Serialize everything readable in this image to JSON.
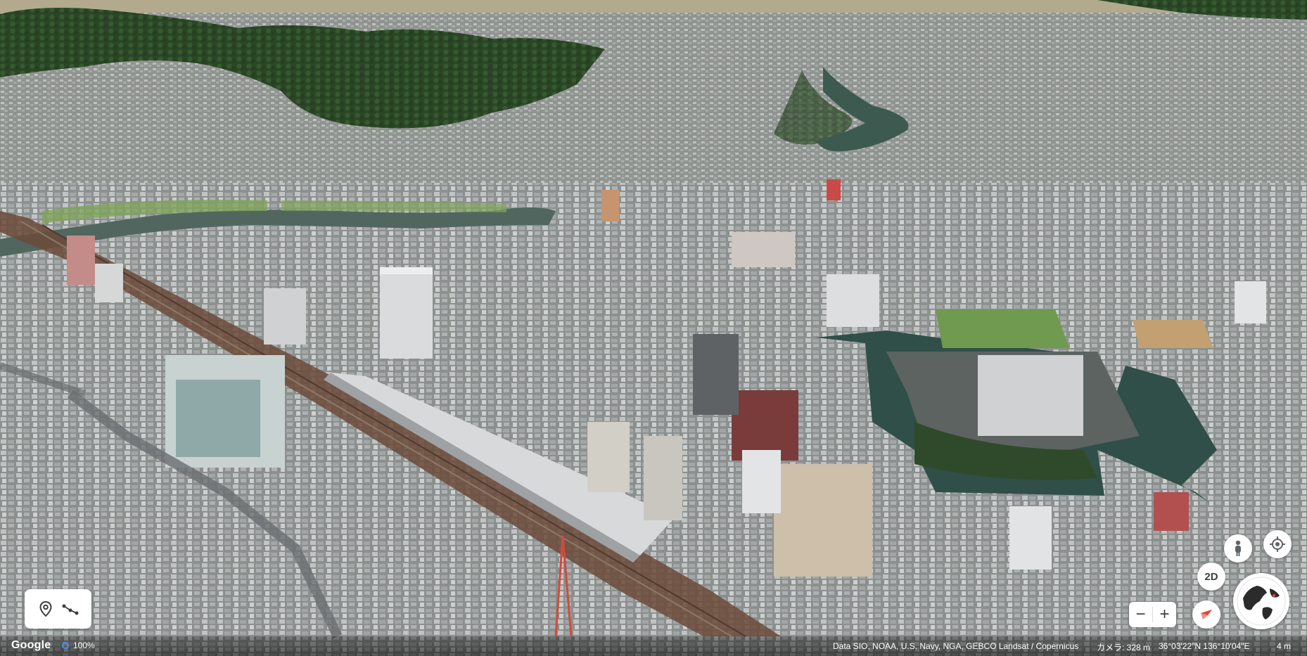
{
  "map": {
    "view": "3d-aerial-city",
    "colors": {
      "water": "#2f4f48",
      "forest": "#2e4a2a",
      "rooftops": "#b9bcc0",
      "field": "#7fa45a",
      "rail": "#6b4a3a"
    }
  },
  "left_controls": {
    "pin_icon": "map-pin-icon",
    "route_icon": "route-line-icon"
  },
  "right_controls": {
    "streetview_icon": "pegman-icon",
    "location_icon": "my-location-icon",
    "mode_label": "2D",
    "compass_icon": "compass-needle-icon",
    "zoom_out_label": "−",
    "zoom_in_label": "+",
    "globe_icon": "globe-icon"
  },
  "footer": {
    "logo": "Google",
    "loading_percent": "100%",
    "attribution": "Data SIO, NOAA, U.S. Navy, NGA, GEBCO  Landsat / Copernicus",
    "camera": "カメラ: 328 m",
    "coordinates": "36°03'22\"N 136°10'04\"E",
    "scale": "4 m"
  }
}
